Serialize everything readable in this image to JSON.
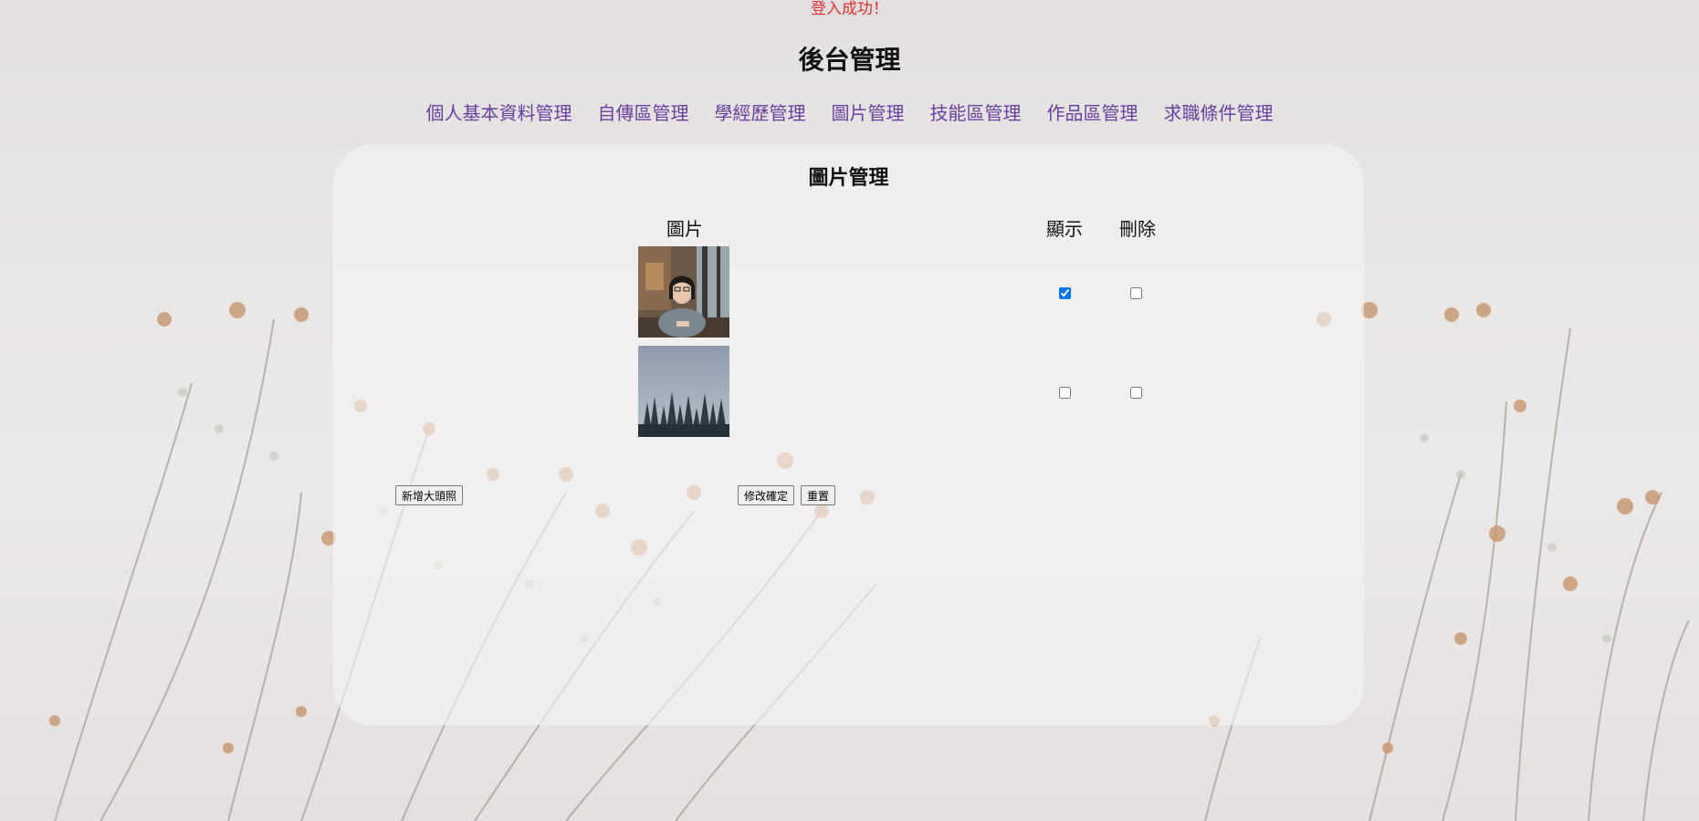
{
  "status": {
    "login_message": "登入成功！"
  },
  "header": {
    "title": "後台管理"
  },
  "nav": {
    "items": [
      "個人基本資料管理",
      "自傳區管理",
      "學經歷管理",
      "圖片管理",
      "技能區管理",
      "作品區管理",
      "求職條件管理"
    ]
  },
  "panel": {
    "title": "圖片管理",
    "columns": {
      "image": "圖片",
      "show": "顯示",
      "delete": "刪除"
    },
    "rows": [
      {
        "image_desc": "portrait",
        "show": true,
        "delete": false
      },
      {
        "image_desc": "forest",
        "show": false,
        "delete": false
      }
    ],
    "buttons": {
      "add": "新增大頭照",
      "confirm": "修改確定",
      "reset": "重置"
    }
  },
  "colors": {
    "login_message": "#e03030",
    "nav_link": "#6a3ea1"
  }
}
